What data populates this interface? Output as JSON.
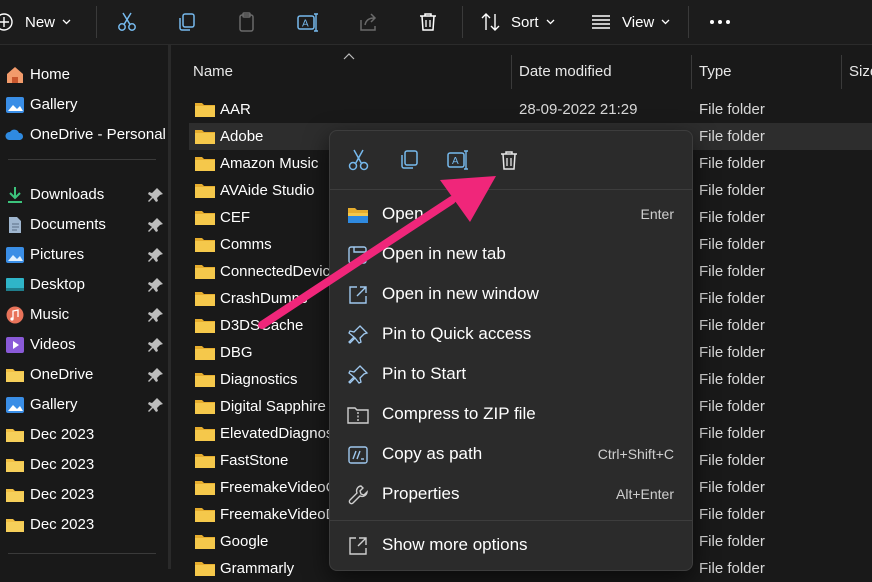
{
  "colors": {
    "accent": "#76b9ed",
    "folder": "#f2c044",
    "arrow": "#f0267a",
    "background": "#191919",
    "menu": "#2b2b2b"
  },
  "toolbar": {
    "new_label": "New",
    "sort_label": "Sort",
    "view_label": "View",
    "icons": [
      "plus-icon",
      "cut-icon",
      "copy-icon",
      "paste-icon",
      "rename-icon",
      "share-icon",
      "delete-icon",
      "sort-icon",
      "view-icon",
      "more-icon"
    ]
  },
  "sidebar": {
    "items": [
      {
        "label": "Home",
        "icon": "home-icon",
        "pinned": false
      },
      {
        "label": "Gallery",
        "icon": "gallery-icon",
        "pinned": false
      },
      {
        "label": "OneDrive - Personal",
        "icon": "cloud-icon",
        "pinned": false
      },
      {
        "label": "Downloads",
        "icon": "download-icon",
        "pinned": true
      },
      {
        "label": "Documents",
        "icon": "document-icon",
        "pinned": true
      },
      {
        "label": "Pictures",
        "icon": "pictures-icon",
        "pinned": true
      },
      {
        "label": "Desktop",
        "icon": "desktop-icon",
        "pinned": true
      },
      {
        "label": "Music",
        "icon": "music-icon",
        "pinned": true
      },
      {
        "label": "Videos",
        "icon": "videos-icon",
        "pinned": true
      },
      {
        "label": "OneDrive",
        "icon": "folder-icon",
        "pinned": true
      },
      {
        "label": "Gallery",
        "icon": "gallery-icon",
        "pinned": true
      },
      {
        "label": "Dec 2023",
        "icon": "folder-icon",
        "pinned": false
      },
      {
        "label": "Dec 2023",
        "icon": "folder-icon",
        "pinned": false
      },
      {
        "label": "Dec 2023",
        "icon": "folder-icon",
        "pinned": false
      },
      {
        "label": "Dec 2023",
        "icon": "folder-icon",
        "pinned": false
      }
    ]
  },
  "columns": {
    "name": "Name",
    "date": "Date modified",
    "type": "Type",
    "size": "Size"
  },
  "files": [
    {
      "name": "AAR",
      "date": "28-09-2022 21:29",
      "type": "File folder"
    },
    {
      "name": "Adobe",
      "date": "",
      "type": "File folder"
    },
    {
      "name": "Amazon Music",
      "date": "",
      "type": "File folder"
    },
    {
      "name": "AVAide Studio",
      "date": "",
      "type": "File folder"
    },
    {
      "name": "CEF",
      "date": "",
      "type": "File folder"
    },
    {
      "name": "Comms",
      "date": "",
      "type": "File folder"
    },
    {
      "name": "ConnectedDevic",
      "date": "",
      "type": "File folder"
    },
    {
      "name": "CrashDumps",
      "date": "",
      "type": "File folder"
    },
    {
      "name": "D3DSCache",
      "date": "",
      "type": "File folder"
    },
    {
      "name": "DBG",
      "date": "",
      "type": "File folder"
    },
    {
      "name": "Diagnostics",
      "date": "",
      "type": "File folder"
    },
    {
      "name": "Digital Sapphire",
      "date": "",
      "type": "File folder"
    },
    {
      "name": "ElevatedDiagnos",
      "date": "",
      "type": "File folder"
    },
    {
      "name": "FastStone",
      "date": "",
      "type": "File folder"
    },
    {
      "name": "FreemakeVideoC",
      "date": "",
      "type": "File folder"
    },
    {
      "name": "FreemakeVideoD",
      "date": "",
      "type": "File folder"
    },
    {
      "name": "Google",
      "date": "",
      "type": "File folder"
    },
    {
      "name": "Grammarly",
      "date": "",
      "type": "File folder"
    }
  ],
  "context_menu": {
    "quick_actions": [
      "cut-icon",
      "copy-icon",
      "rename-icon",
      "delete-icon"
    ],
    "items": [
      {
        "label": "Open",
        "shortcut": "Enter",
        "icon": "folder-open-icon"
      },
      {
        "label": "Open in new tab",
        "shortcut": "",
        "icon": "new-tab-icon"
      },
      {
        "label": "Open in new window",
        "shortcut": "",
        "icon": "new-window-icon"
      },
      {
        "label": "Pin to Quick access",
        "shortcut": "",
        "icon": "pin-icon"
      },
      {
        "label": "Pin to Start",
        "shortcut": "",
        "icon": "pin-icon"
      },
      {
        "label": "Compress to ZIP file",
        "shortcut": "",
        "icon": "zip-icon"
      },
      {
        "label": "Copy as path",
        "shortcut": "Ctrl+Shift+C",
        "icon": "copy-path-icon"
      },
      {
        "label": "Properties",
        "shortcut": "Alt+Enter",
        "icon": "wrench-icon"
      },
      {
        "label": "Show more options",
        "shortcut": "",
        "icon": "more-options-icon"
      }
    ]
  }
}
